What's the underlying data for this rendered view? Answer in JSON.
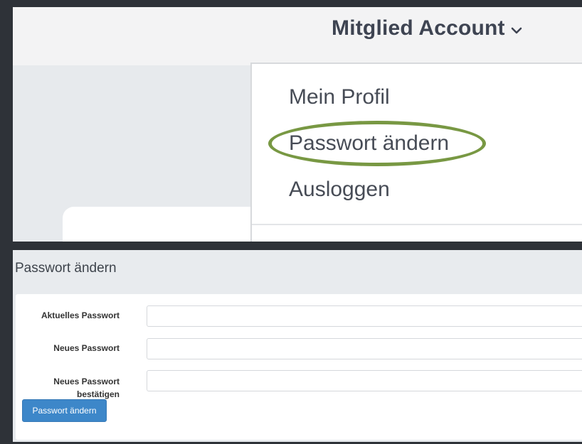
{
  "account_menu": {
    "trigger_label": "Mitglied Account",
    "trigger_icon": "chevron-down-icon",
    "items": [
      {
        "label": "Mein Profil"
      },
      {
        "label": "Passwort ändern",
        "highlighted": true
      },
      {
        "label": "Ausloggen"
      }
    ],
    "highlight_color": "#789843"
  },
  "password_form": {
    "title": "Passwort ändern",
    "fields": [
      {
        "label": "Aktuelles Passwort",
        "value": ""
      },
      {
        "label": "Neues Passwort",
        "value": ""
      },
      {
        "label_line1": "Neues Passwort",
        "label_line2": "bestätigen",
        "value": ""
      }
    ],
    "submit_label": "Passwort ändern",
    "button_color": "#3d87c9"
  }
}
